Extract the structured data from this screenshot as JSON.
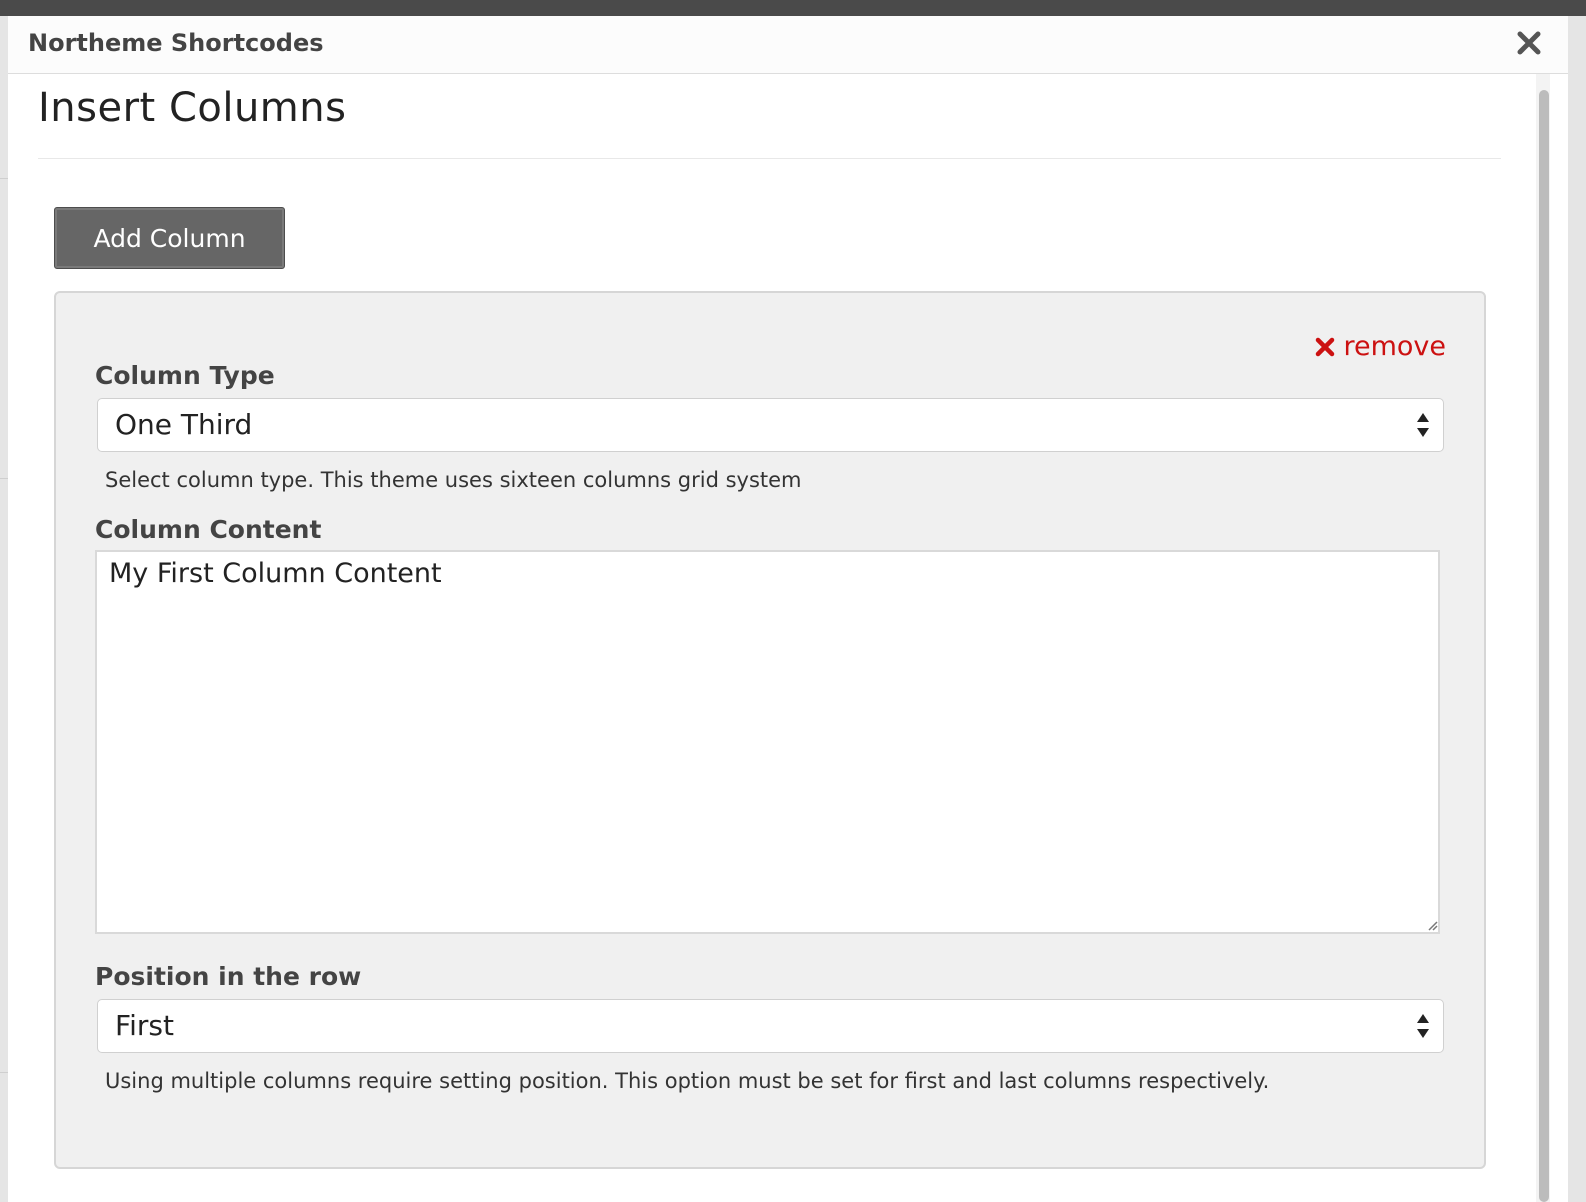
{
  "dialog": {
    "title": "Northeme Shortcodes",
    "heading": "Insert Columns"
  },
  "toolbar": {
    "add_label": "Add Column"
  },
  "column": {
    "remove_label": "remove",
    "type": {
      "label": "Column Type",
      "value": "One Third",
      "help": "Select column type. This theme uses sixteen columns grid system"
    },
    "content": {
      "label": "Column Content",
      "value": "My First Column Content"
    },
    "position": {
      "label": "Position in the row",
      "value": "First",
      "help": "Using multiple columns require setting position. This option must be set for first and last columns respectively."
    }
  },
  "colors": {
    "remove": "#cc1111",
    "button": "#666666",
    "panel": "#f0f0f0"
  },
  "icons": {
    "close": "close-icon",
    "remove": "x-icon",
    "select": "updown-arrows-icon",
    "resize": "resize-handle-icon"
  }
}
